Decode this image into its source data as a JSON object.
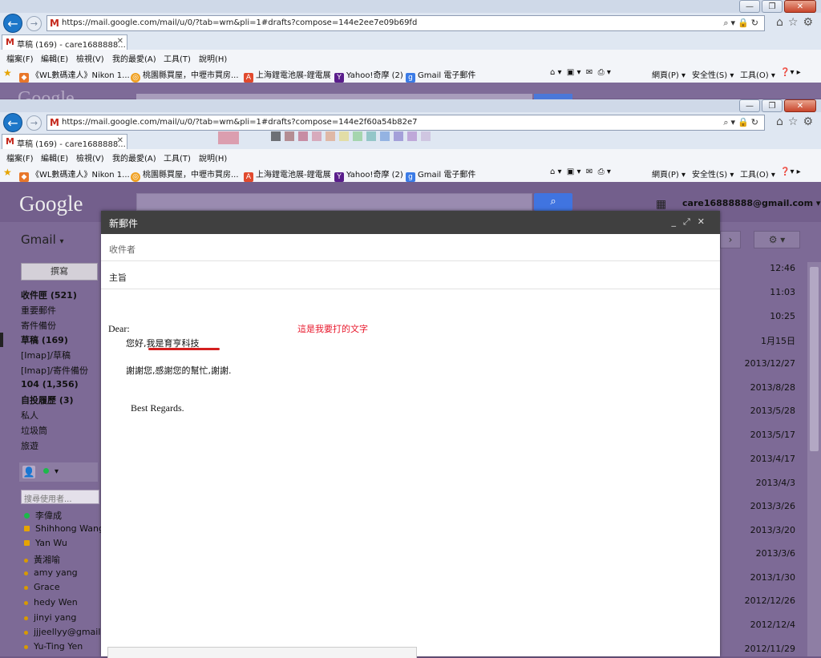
{
  "browser": {
    "front_url": "https://mail.google.com/mail/u/0/?tab=wm&pli=1#drafts?compose=144e2f60a54b82e7",
    "back_url": "https://mail.google.com/mail/u/0/?tab=wm&pli=1#drafts?compose=144e2ee7e09b69fd",
    "tab_label": "草稿 (169) - care1688888...",
    "menu": [
      "檔案(F)",
      "編輯(E)",
      "檢視(V)",
      "我的最愛(A)",
      "工具(T)",
      "說明(H)"
    ],
    "favorites": [
      "《WL數碼達人》Nikon 1...",
      "桃園縣買屋，中壢市買房...",
      "上海鋰電池展-鋰電展",
      "Yahoo!奇摩 (2)",
      "Gmail 電子郵件"
    ],
    "commands": [
      "網頁(P)",
      "安全性(S)",
      "工具(O)"
    ]
  },
  "gmail": {
    "logo": "Google",
    "label": "Gmail",
    "account": "care16888888@gmail.com",
    "compose_button": "撰寫",
    "nav": [
      {
        "label": "收件匣 (521)",
        "bold": true
      },
      {
        "label": "重要郵件",
        "bold": false
      },
      {
        "label": "寄件備份",
        "bold": false
      },
      {
        "label": "草稿 (169)",
        "bold": true
      },
      {
        "label": "[Imap]/草稿",
        "bold": false
      },
      {
        "label": "[Imap]/寄件備份",
        "bold": false
      },
      {
        "label": "104 (1,356)",
        "bold": true
      },
      {
        "label": "自投履歷 (3)",
        "bold": true
      },
      {
        "label": "私人",
        "bold": false
      },
      {
        "label": "垃圾筒",
        "bold": false
      },
      {
        "label": "旅遊",
        "bold": false
      }
    ],
    "chat_search_placeholder": "搜尋使用者...",
    "contacts": [
      "李偉成",
      "Shihhong Wang",
      "Yan Wu",
      "黃湘喻",
      "amy yang",
      "Grace",
      "hedy Wen",
      "jinyi yang",
      "jjjeellyy@gmail.",
      "Yu-Ting Yen"
    ],
    "dates": [
      "12:46",
      "11:03",
      "10:25",
      "1月15日",
      "2013/12/27",
      "2013/8/28",
      "2013/5/28",
      "2013/5/17",
      "2013/4/17",
      "2013/4/3",
      "2013/3/26",
      "2013/3/20",
      "2013/3/6",
      "2013/1/30",
      "2012/12/26",
      "2012/12/4",
      "2012/11/29"
    ]
  },
  "compose": {
    "title": "新郵件",
    "to_label": "收件者",
    "subject_label": "主旨",
    "greeting": "Dear:",
    "line1_prefix": "您好,",
    "line1_highlight": "我是育亨科技",
    "line2": "謝謝您,感謝您的幫忙,謝謝.",
    "closing": "Best Regards.",
    "annotation": "這是我要打的文字"
  }
}
